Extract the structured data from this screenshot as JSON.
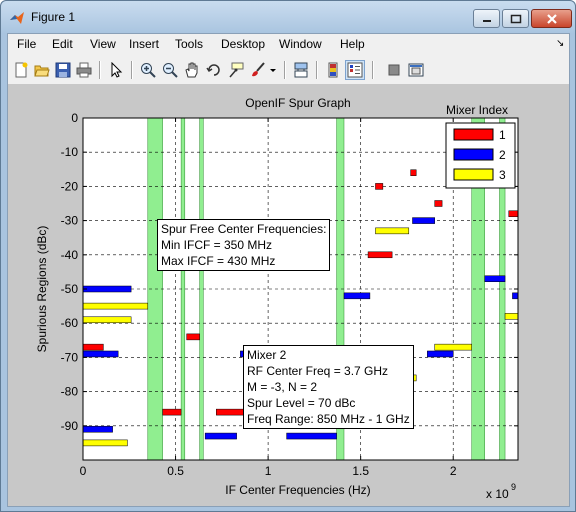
{
  "window": {
    "title": "Figure 1"
  },
  "menu": [
    "File",
    "Edit",
    "View",
    "Insert",
    "Tools",
    "Desktop",
    "Window",
    "Help"
  ],
  "toolbar_icons": [
    "new-figure-icon",
    "open-file-icon",
    "save-icon",
    "print-icon",
    "edit-plot-arrow-icon",
    "zoom-in-icon",
    "zoom-out-icon",
    "pan-hand-icon",
    "rotate-3d-icon",
    "data-cursor-icon",
    "brush-icon",
    "link-plot-icon",
    "insert-colorbar-icon",
    "insert-legend-icon",
    "hide-plot-tools-icon",
    "show-plot-tools-icon"
  ],
  "chart_data": {
    "type": "bar",
    "title": "OpenIF Spur Graph",
    "xlabel": "IF Center Frequencies (Hz)",
    "ylabel": "Spurious Regions (dBc)",
    "x_exponent_label": "x 10",
    "x_exponent_power": "9",
    "xlim": [
      0,
      2350000000.0
    ],
    "ylim": [
      -100,
      0
    ],
    "xticks": [
      0,
      0.5,
      1,
      1.5,
      2
    ],
    "yticks": [
      0,
      -10,
      -20,
      -30,
      -40,
      -50,
      -60,
      -70,
      -80,
      -90
    ],
    "grid": true,
    "legend": {
      "title": "Mixer Index",
      "placement": "top-right",
      "entries": [
        {
          "label": "1",
          "color": "#ff0000"
        },
        {
          "label": "2",
          "color": "#0000ff"
        },
        {
          "label": "3",
          "color": "#ffff00"
        }
      ]
    },
    "spur_free_bands_ghz": [
      [
        0.35,
        0.43
      ],
      [
        0.53,
        0.55
      ],
      [
        0.63,
        0.65
      ],
      [
        1.37,
        1.41
      ],
      [
        2.1,
        2.17
      ],
      [
        2.25,
        2.28
      ]
    ],
    "spur_free_color": "#90ee90",
    "spurs": [
      {
        "mixer": 1,
        "x1": 0.0,
        "x2": 0.11,
        "level": -67
      },
      {
        "mixer": 1,
        "x1": 0.43,
        "x2": 0.53,
        "level": -86
      },
      {
        "mixer": 1,
        "x1": 0.56,
        "x2": 0.63,
        "level": -64
      },
      {
        "mixer": 1,
        "x1": 0.72,
        "x2": 0.89,
        "level": -86
      },
      {
        "mixer": 1,
        "x1": 0.92,
        "x2": 1.0,
        "level": -40
      },
      {
        "mixer": 1,
        "x1": 1.54,
        "x2": 1.67,
        "level": -40
      },
      {
        "mixer": 1,
        "x1": 1.58,
        "x2": 1.62,
        "level": -20
      },
      {
        "mixer": 1,
        "x1": 1.77,
        "x2": 1.8,
        "level": -16
      },
      {
        "mixer": 1,
        "x1": 1.9,
        "x2": 1.94,
        "level": -25
      },
      {
        "mixer": 1,
        "x1": 2.3,
        "x2": 2.35,
        "level": -28
      },
      {
        "mixer": 2,
        "x1": 0.0,
        "x2": 0.26,
        "level": -50
      },
      {
        "mixer": 2,
        "x1": 0.0,
        "x2": 0.19,
        "level": -69
      },
      {
        "mixer": 2,
        "x1": 0.0,
        "x2": 0.16,
        "level": -91
      },
      {
        "mixer": 2,
        "x1": 0.66,
        "x2": 0.83,
        "level": -93
      },
      {
        "mixer": 2,
        "x1": 0.85,
        "x2": 0.95,
        "level": -69
      },
      {
        "mixer": 2,
        "x1": 1.1,
        "x2": 1.37,
        "level": -93
      },
      {
        "mixer": 2,
        "x1": 1.41,
        "x2": 1.55,
        "level": -52
      },
      {
        "mixer": 2,
        "x1": 1.78,
        "x2": 1.9,
        "level": -30
      },
      {
        "mixer": 2,
        "x1": 1.86,
        "x2": 2.0,
        "level": -69
      },
      {
        "mixer": 2,
        "x1": 2.17,
        "x2": 2.28,
        "level": -47
      },
      {
        "mixer": 2,
        "x1": 2.32,
        "x2": 2.35,
        "level": -52
      },
      {
        "mixer": 3,
        "x1": 0.0,
        "x2": 0.35,
        "level": -55
      },
      {
        "mixer": 3,
        "x1": 0.0,
        "x2": 0.26,
        "level": -59
      },
      {
        "mixer": 3,
        "x1": 0.0,
        "x2": 0.24,
        "level": -95
      },
      {
        "mixer": 3,
        "x1": 1.58,
        "x2": 1.76,
        "level": -33
      },
      {
        "mixer": 3,
        "x1": 1.73,
        "x2": 1.8,
        "level": -76
      },
      {
        "mixer": 3,
        "x1": 1.9,
        "x2": 2.1,
        "level": -67
      },
      {
        "mixer": 3,
        "x1": 2.28,
        "x2": 2.35,
        "level": -58
      }
    ]
  },
  "annotations": {
    "spur_free": {
      "line1": "Spur Free Center Frequencies:",
      "line2": "Min IFCF = 350 MHz",
      "line3": "Max IFCF = 430 MHz"
    },
    "datatip": {
      "line1": "Mixer 2",
      "line2": "RF Center Freq = 3.7 GHz",
      "line3": "M = -3, N = 2",
      "line4": "Spur Level = 70 dBc",
      "line5": "Freq Range: 850 MHz - 1 GHz"
    }
  }
}
